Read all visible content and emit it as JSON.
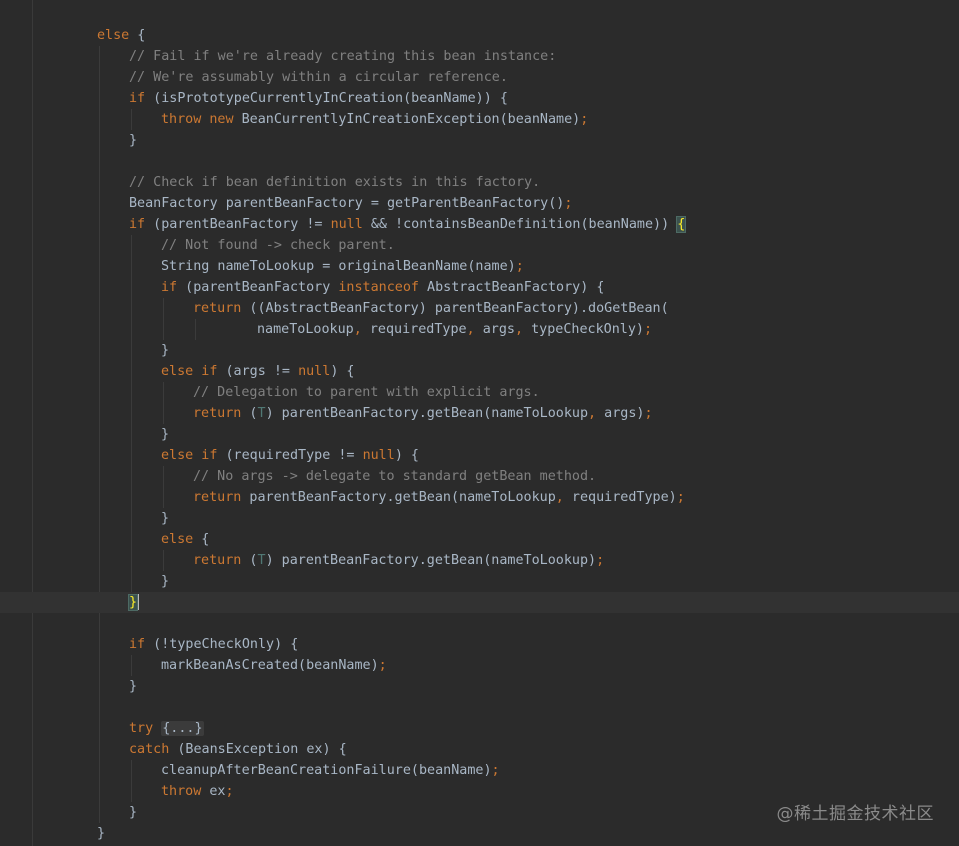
{
  "editor": {
    "language": "java",
    "caret_line": 28,
    "lines": [
      {
        "indent": 0,
        "tokens": []
      },
      {
        "indent": 2,
        "tokens": [
          {
            "t": "kw",
            "s": "else"
          },
          {
            "t": "default",
            "s": " {"
          }
        ]
      },
      {
        "indent": 3,
        "tokens": [
          {
            "t": "comment",
            "s": "// Fail if we're already creating this bean instance:"
          }
        ]
      },
      {
        "indent": 3,
        "tokens": [
          {
            "t": "comment",
            "s": "// We're assumably within a circular reference."
          }
        ]
      },
      {
        "indent": 3,
        "tokens": [
          {
            "t": "kw",
            "s": "if"
          },
          {
            "t": "default",
            "s": " (isPrototypeCurrentlyInCreation(beanName)) {"
          }
        ]
      },
      {
        "indent": 4,
        "tokens": [
          {
            "t": "kw",
            "s": "throw new"
          },
          {
            "t": "default",
            "s": " BeanCurrentlyInCreationException(beanName)"
          },
          {
            "t": "kw",
            "s": ";"
          }
        ]
      },
      {
        "indent": 3,
        "tokens": [
          {
            "t": "default",
            "s": "}"
          }
        ]
      },
      {
        "indent": 0,
        "tokens": []
      },
      {
        "indent": 3,
        "tokens": [
          {
            "t": "comment",
            "s": "// Check if bean definition exists in this factory."
          }
        ]
      },
      {
        "indent": 3,
        "tokens": [
          {
            "t": "default",
            "s": "BeanFactory parentBeanFactory = getParentBeanFactory()"
          },
          {
            "t": "kw",
            "s": ";"
          }
        ]
      },
      {
        "indent": 3,
        "tokens": [
          {
            "t": "kw",
            "s": "if"
          },
          {
            "t": "default",
            "s": " (parentBeanFactory != "
          },
          {
            "t": "kw",
            "s": "null"
          },
          {
            "t": "default",
            "s": " && !containsBeanDefinition(beanName)) "
          },
          {
            "t": "match",
            "s": "{"
          }
        ]
      },
      {
        "indent": 4,
        "tokens": [
          {
            "t": "comment",
            "s": "// Not found -> check parent."
          }
        ]
      },
      {
        "indent": 4,
        "tokens": [
          {
            "t": "default",
            "s": "String nameToLookup = originalBeanName(name)"
          },
          {
            "t": "kw",
            "s": ";"
          }
        ]
      },
      {
        "indent": 4,
        "tokens": [
          {
            "t": "kw",
            "s": "if"
          },
          {
            "t": "default",
            "s": " (parentBeanFactory "
          },
          {
            "t": "kw",
            "s": "instanceof"
          },
          {
            "t": "default",
            "s": " AbstractBeanFactory) {"
          }
        ]
      },
      {
        "indent": 5,
        "tokens": [
          {
            "t": "kw",
            "s": "return"
          },
          {
            "t": "default",
            "s": " ((AbstractBeanFactory) parentBeanFactory).doGetBean("
          }
        ]
      },
      {
        "indent": 7,
        "tokens": [
          {
            "t": "default",
            "s": "nameToLookup"
          },
          {
            "t": "kw",
            "s": ","
          },
          {
            "t": "default",
            "s": " requiredType"
          },
          {
            "t": "kw",
            "s": ","
          },
          {
            "t": "default",
            "s": " args"
          },
          {
            "t": "kw",
            "s": ","
          },
          {
            "t": "default",
            "s": " typeCheckOnly)"
          },
          {
            "t": "kw",
            "s": ";"
          }
        ]
      },
      {
        "indent": 4,
        "tokens": [
          {
            "t": "default",
            "s": "}"
          }
        ]
      },
      {
        "indent": 4,
        "tokens": [
          {
            "t": "kw",
            "s": "else if"
          },
          {
            "t": "default",
            "s": " (args != "
          },
          {
            "t": "kw",
            "s": "null"
          },
          {
            "t": "default",
            "s": ") {"
          }
        ]
      },
      {
        "indent": 5,
        "tokens": [
          {
            "t": "comment",
            "s": "// Delegation to parent with explicit args."
          }
        ]
      },
      {
        "indent": 5,
        "tokens": [
          {
            "t": "kw",
            "s": "return"
          },
          {
            "t": "default",
            "s": " ("
          },
          {
            "t": "type",
            "s": "T"
          },
          {
            "t": "default",
            "s": ") parentBeanFactory.getBean(nameToLookup"
          },
          {
            "t": "kw",
            "s": ","
          },
          {
            "t": "default",
            "s": " args)"
          },
          {
            "t": "kw",
            "s": ";"
          }
        ]
      },
      {
        "indent": 4,
        "tokens": [
          {
            "t": "default",
            "s": "}"
          }
        ]
      },
      {
        "indent": 4,
        "tokens": [
          {
            "t": "kw",
            "s": "else if"
          },
          {
            "t": "default",
            "s": " (requiredType != "
          },
          {
            "t": "kw",
            "s": "null"
          },
          {
            "t": "default",
            "s": ") {"
          }
        ]
      },
      {
        "indent": 5,
        "tokens": [
          {
            "t": "comment",
            "s": "// No args -> delegate to standard getBean method."
          }
        ]
      },
      {
        "indent": 5,
        "tokens": [
          {
            "t": "kw",
            "s": "return"
          },
          {
            "t": "default",
            "s": " parentBeanFactory.getBean(nameToLookup"
          },
          {
            "t": "kw",
            "s": ","
          },
          {
            "t": "default",
            "s": " requiredType)"
          },
          {
            "t": "kw",
            "s": ";"
          }
        ]
      },
      {
        "indent": 4,
        "tokens": [
          {
            "t": "default",
            "s": "}"
          }
        ]
      },
      {
        "indent": 4,
        "tokens": [
          {
            "t": "kw",
            "s": "else"
          },
          {
            "t": "default",
            "s": " {"
          }
        ]
      },
      {
        "indent": 5,
        "tokens": [
          {
            "t": "kw",
            "s": "return"
          },
          {
            "t": "default",
            "s": " ("
          },
          {
            "t": "type",
            "s": "T"
          },
          {
            "t": "default",
            "s": ") parentBeanFactory.getBean(nameToLookup)"
          },
          {
            "t": "kw",
            "s": ";"
          }
        ]
      },
      {
        "indent": 4,
        "tokens": [
          {
            "t": "default",
            "s": "}"
          }
        ]
      },
      {
        "indent": 3,
        "tokens": [
          {
            "t": "match",
            "s": "}"
          },
          {
            "t": "caret",
            "s": ""
          }
        ]
      },
      {
        "indent": 0,
        "tokens": []
      },
      {
        "indent": 3,
        "tokens": [
          {
            "t": "kw",
            "s": "if"
          },
          {
            "t": "default",
            "s": " (!typeCheckOnly) {"
          }
        ]
      },
      {
        "indent": 4,
        "tokens": [
          {
            "t": "default",
            "s": "markBeanAsCreated(beanName)"
          },
          {
            "t": "kw",
            "s": ";"
          }
        ]
      },
      {
        "indent": 3,
        "tokens": [
          {
            "t": "default",
            "s": "}"
          }
        ]
      },
      {
        "indent": 0,
        "tokens": []
      },
      {
        "indent": 3,
        "tokens": [
          {
            "t": "kw",
            "s": "try"
          },
          {
            "t": "default",
            "s": " "
          },
          {
            "t": "fold",
            "s": "{...}"
          }
        ]
      },
      {
        "indent": 3,
        "tokens": [
          {
            "t": "kw",
            "s": "catch"
          },
          {
            "t": "default",
            "s": " (BeansException ex) {"
          }
        ]
      },
      {
        "indent": 4,
        "tokens": [
          {
            "t": "default",
            "s": "cleanupAfterBeanCreationFailure(beanName)"
          },
          {
            "t": "kw",
            "s": ";"
          }
        ]
      },
      {
        "indent": 4,
        "tokens": [
          {
            "t": "kw",
            "s": "throw"
          },
          {
            "t": "default",
            "s": " ex"
          },
          {
            "t": "kw",
            "s": ";"
          }
        ]
      },
      {
        "indent": 3,
        "tokens": [
          {
            "t": "default",
            "s": "}"
          }
        ]
      },
      {
        "indent": 2,
        "tokens": [
          {
            "t": "default",
            "s": "}"
          }
        ]
      }
    ]
  },
  "colors": {
    "background": "#2b2b2b",
    "current_line": "#323232",
    "default": "#a9b7c6",
    "keyword": "#cc7832",
    "comment": "#808080",
    "type_param": "#507874",
    "bracket_match": "#ffef28"
  },
  "watermark": {
    "text": "@稀土掘金技术社区"
  }
}
